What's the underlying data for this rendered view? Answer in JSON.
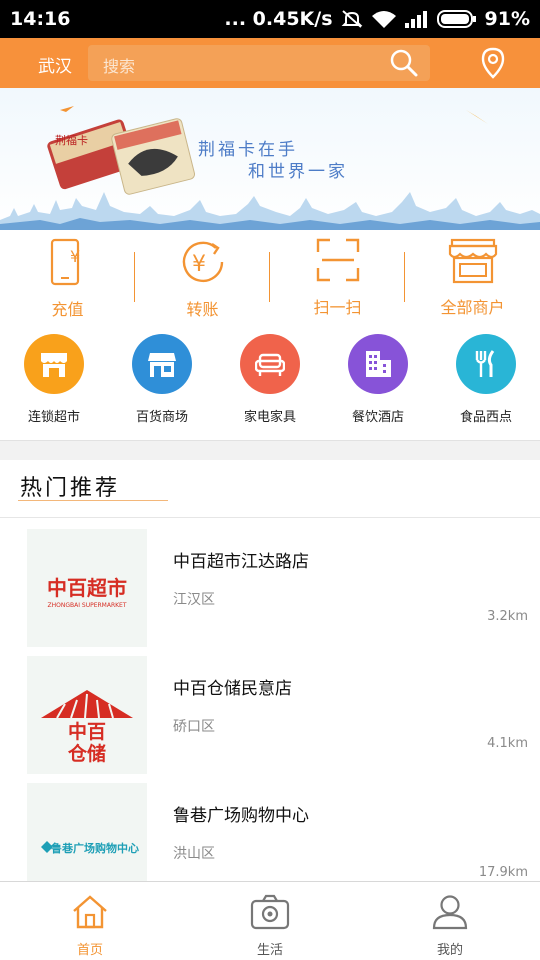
{
  "status_bar": {
    "time": "14:16",
    "speed": "... 0.45K/s",
    "battery": "91%"
  },
  "header": {
    "city": "武汉",
    "search_placeholder": "搜索"
  },
  "banner": {
    "line1": "荆福卡在手",
    "line2": "和世界一家",
    "card_text": "荆福卡"
  },
  "quick_actions": [
    {
      "label": "充值",
      "icon": "phone-yen-icon"
    },
    {
      "label": "转账",
      "icon": "transfer-yen-icon"
    },
    {
      "label": "扫一扫",
      "icon": "scan-icon"
    },
    {
      "label": "全部商户",
      "icon": "storefront-icon"
    }
  ],
  "categories": [
    {
      "label": "连锁超市",
      "icon": "store-awning-icon",
      "color": "#f9a11b"
    },
    {
      "label": "百货商场",
      "icon": "shop-icon",
      "color": "#2f8fd8"
    },
    {
      "label": "家电家具",
      "icon": "sofa-icon",
      "color": "#f0634b"
    },
    {
      "label": "餐饮酒店",
      "icon": "building-icon",
      "color": "#8753d8"
    },
    {
      "label": "食品西点",
      "icon": "fork-knife-icon",
      "color": "#29b5d6"
    }
  ],
  "hot": {
    "title": "热门推荐",
    "stores": [
      {
        "name": "中百超市江达路店",
        "district": "江汉区",
        "distance": "3.2km",
        "logo_text": "中百超市",
        "logo_sub": "ZHONGBAI SUPERMARKET"
      },
      {
        "name": "中百仓储民意店",
        "district": "硚口区",
        "distance": "4.1km",
        "logo_text": "中百",
        "logo_text2": "仓储"
      },
      {
        "name": "鲁巷广场购物中心",
        "district": "洪山区",
        "distance": "17.9km",
        "logo_text": "鲁巷广场购物中心"
      }
    ]
  },
  "bottom_nav": [
    {
      "label": "首页",
      "icon": "home-icon",
      "active": true
    },
    {
      "label": "生活",
      "icon": "camera-icon",
      "active": false
    },
    {
      "label": "我的",
      "icon": "user-icon",
      "active": false
    }
  ],
  "colors": {
    "accent": "#f7913b",
    "accent_text": "#f39433"
  }
}
